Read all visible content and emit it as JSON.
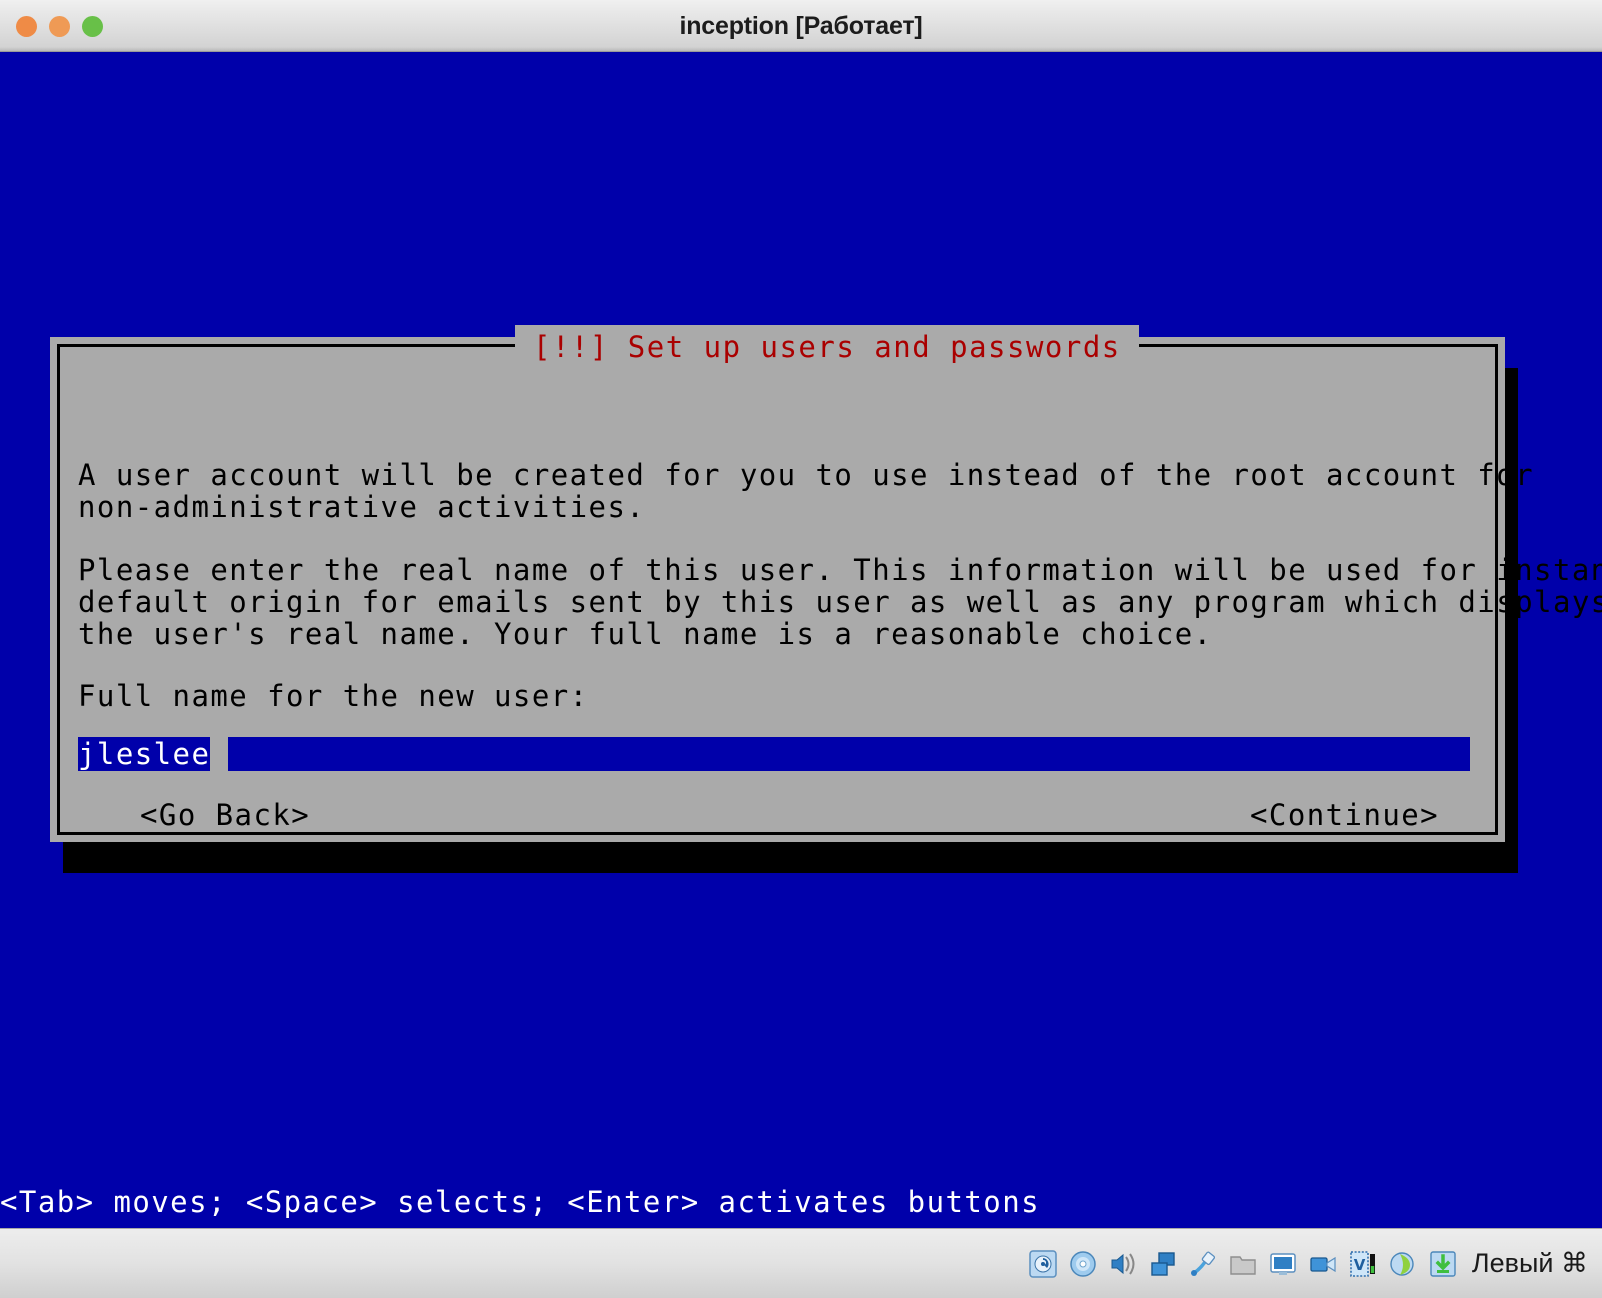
{
  "window": {
    "title": "inception [Работает]",
    "buttons": {
      "close": "close-button",
      "minimize": "minimize-button",
      "zoom": "zoom-button"
    }
  },
  "dialog": {
    "title": "[!!] Set up users and passwords",
    "title_color": "#aa0000",
    "background": "#aaaaaa",
    "paragraph1": "A user account will be created for you to use instead of the root account for\nnon-administrative activities.",
    "paragraph2": "Please enter the real name of this user. This information will be used for instance as\ndefault origin for emails sent by this user as well as any program which displays or uses\nthe user's real name. Your full name is a reasonable choice.",
    "field_label": "Full name for the new user:",
    "input": {
      "value": "jleslee",
      "placeholder": "",
      "highlight_color": "#0000aa",
      "text_color": "#ffffff"
    },
    "buttons": {
      "go_back": "<Go Back>",
      "continue": "<Continue>"
    }
  },
  "console": {
    "background": "#0000aa",
    "hint": "<Tab> moves; <Space> selects; <Enter> activates buttons"
  },
  "statusbar": {
    "host_key": "Левый ⌘",
    "icons": [
      {
        "name": "hard-disk-icon"
      },
      {
        "name": "optical-disk-icon"
      },
      {
        "name": "audio-icon"
      },
      {
        "name": "network-icon"
      },
      {
        "name": "usb-icon"
      },
      {
        "name": "shared-folders-icon"
      },
      {
        "name": "display-icon"
      },
      {
        "name": "recording-icon"
      },
      {
        "name": "virtualization-icon"
      },
      {
        "name": "mouse-integration-icon"
      },
      {
        "name": "keyboard-capture-icon"
      }
    ]
  }
}
